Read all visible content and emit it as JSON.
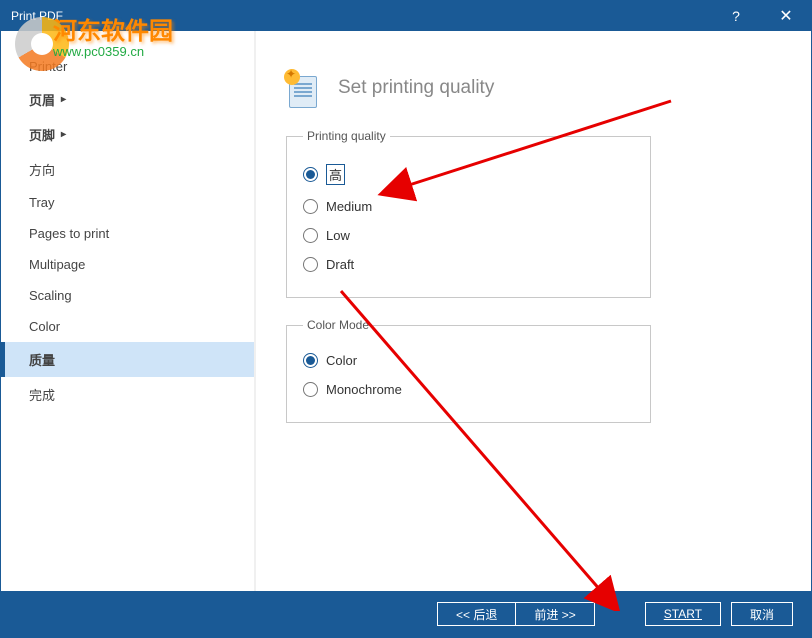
{
  "window": {
    "title": "Print PDF",
    "help": "?",
    "close": "✕"
  },
  "watermark": {
    "line1": "河东软件园",
    "line2": "www.pc0359.cn"
  },
  "sidebar": {
    "items": [
      {
        "label": "Printer",
        "bold": false,
        "hasChevron": false
      },
      {
        "label": "页眉",
        "bold": true,
        "hasChevron": true
      },
      {
        "label": "页脚",
        "bold": true,
        "hasChevron": true
      },
      {
        "label": "方向",
        "bold": false,
        "hasChevron": false
      },
      {
        "label": "Tray",
        "bold": false,
        "hasChevron": false
      },
      {
        "label": "Pages to print",
        "bold": false,
        "hasChevron": false
      },
      {
        "label": "Multipage",
        "bold": false,
        "hasChevron": false
      },
      {
        "label": "Scaling",
        "bold": false,
        "hasChevron": false
      },
      {
        "label": "Color",
        "bold": false,
        "hasChevron": false
      }
    ],
    "selected": {
      "label": "质量"
    },
    "last": {
      "label": "完成"
    }
  },
  "content": {
    "heading": "Set printing quality",
    "groups": {
      "quality": {
        "legend": "Printing quality",
        "options": [
          {
            "label": "高",
            "boxed": true
          },
          {
            "label": "Medium",
            "boxed": false
          },
          {
            "label": "Low",
            "boxed": false
          },
          {
            "label": "Draft",
            "boxed": false
          }
        ],
        "selected": 0
      },
      "color": {
        "legend": "Color Mode",
        "options": [
          {
            "label": "Color"
          },
          {
            "label": "Monochrome"
          }
        ],
        "selected": 0
      }
    }
  },
  "footer": {
    "back": "<< 后退",
    "next": "前进 >>",
    "start": "START",
    "cancel": "取消"
  }
}
